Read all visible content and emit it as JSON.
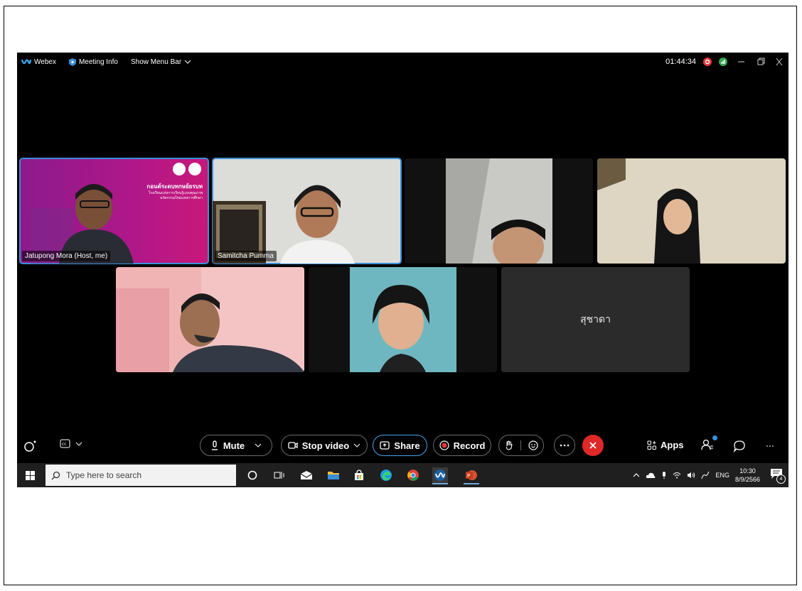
{
  "titlebar": {
    "app_name": "Webex",
    "meeting_info": "Meeting Info",
    "show_menu_bar": "Show Menu Bar",
    "timer": "01:44:34"
  },
  "tiles": [
    {
      "name": "Jatupong Mora (Host, me)",
      "slide_title": "กอนต์ระดบทกษย์ยรบท",
      "slide_sub1": "โรงเรียนแห่งการเรียนรู้แบบคุณภาพ",
      "slide_sub2": "นวัตกรรมใหม่แห่งการศึกษา"
    },
    {
      "name": "Samitcha Pumma"
    },
    {
      "name": ""
    },
    {
      "name": ""
    },
    {
      "name": ""
    },
    {
      "name": ""
    },
    {
      "name": "สุชาดา"
    }
  ],
  "controls": {
    "mute": "Mute",
    "stop_video": "Stop video",
    "share": "Share",
    "record": "Record",
    "apps": "Apps"
  },
  "taskbar": {
    "search_placeholder": "Type here to search",
    "lang": "ENG",
    "time": "10:30",
    "date": "8/9/2566",
    "notifications": "4"
  },
  "colors": {
    "accent_blue": "#3b8fd9",
    "end_red": "#e02828",
    "record_red": "#e8333a",
    "slide_magenta": "#b0178a"
  }
}
